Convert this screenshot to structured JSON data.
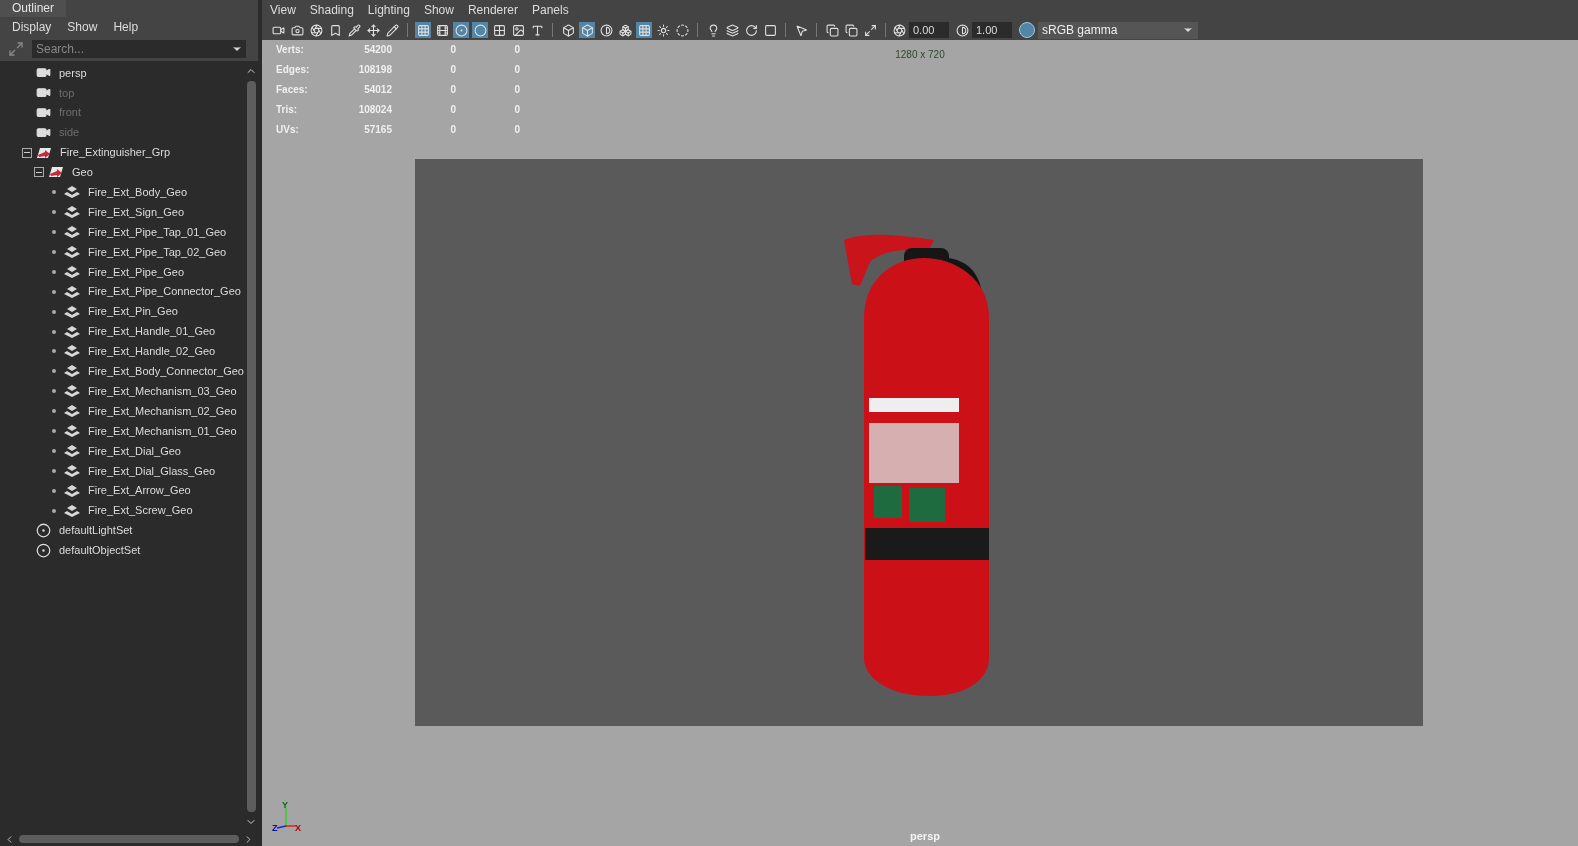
{
  "outliner": {
    "title": "Outliner",
    "menu": [
      "Display",
      "Show",
      "Help"
    ],
    "search": {
      "placeholder": "Search..."
    },
    "items": [
      {
        "kind": "camera",
        "label": "persp",
        "disabled": false
      },
      {
        "kind": "camera",
        "label": "top",
        "disabled": true
      },
      {
        "kind": "camera",
        "label": "front",
        "disabled": true
      },
      {
        "kind": "camera",
        "label": "side",
        "disabled": true
      },
      {
        "kind": "group",
        "label": "Fire_Extinguisher_Grp",
        "expanded": true,
        "children": [
          {
            "kind": "group",
            "label": "Geo",
            "expanded": true,
            "children": [
              {
                "kind": "mesh",
                "label": "Fire_Ext_Body_Geo"
              },
              {
                "kind": "mesh",
                "label": "Fire_Ext_Sign_Geo"
              },
              {
                "kind": "mesh",
                "label": "Fire_Ext_Pipe_Tap_01_Geo"
              },
              {
                "kind": "mesh",
                "label": "Fire_Ext_Pipe_Tap_02_Geo"
              },
              {
                "kind": "mesh",
                "label": "Fire_Ext_Pipe_Geo"
              },
              {
                "kind": "mesh",
                "label": "Fire_Ext_Pipe_Connector_Geo"
              },
              {
                "kind": "mesh",
                "label": "Fire_Ext_Pin_Geo"
              },
              {
                "kind": "mesh",
                "label": "Fire_Ext_Handle_01_Geo"
              },
              {
                "kind": "mesh",
                "label": "Fire_Ext_Handle_02_Geo"
              },
              {
                "kind": "mesh",
                "label": "Fire_Ext_Body_Connector_Geo"
              },
              {
                "kind": "mesh",
                "label": "Fire_Ext_Mechanism_03_Geo"
              },
              {
                "kind": "mesh",
                "label": "Fire_Ext_Mechanism_02_Geo"
              },
              {
                "kind": "mesh",
                "label": "Fire_Ext_Mechanism_01_Geo"
              },
              {
                "kind": "mesh",
                "label": "Fire_Ext_Dial_Geo"
              },
              {
                "kind": "mesh",
                "label": "Fire_Ext_Dial_Glass_Geo"
              },
              {
                "kind": "mesh",
                "label": "Fire_Ext_Arrow_Geo"
              },
              {
                "kind": "mesh",
                "label": "Fire_Ext_Screw_Geo"
              }
            ]
          }
        ]
      },
      {
        "kind": "set",
        "label": "defaultLightSet"
      },
      {
        "kind": "set",
        "label": "defaultObjectSet"
      }
    ]
  },
  "viewport": {
    "menu": [
      "View",
      "Shading",
      "Lighting",
      "Show",
      "Renderer",
      "Panels"
    ],
    "toolbar": [
      {
        "selected": false
      },
      {
        "selected": false
      },
      {
        "selected": false
      },
      {
        "selected": false
      },
      {
        "selected": false
      },
      {
        "selected": false
      },
      {
        "selected": false
      },
      {
        "selected": true
      },
      {
        "selected": false
      },
      {
        "selected": true
      },
      {
        "selected": true
      },
      {
        "selected": false
      },
      {
        "selected": false
      },
      {
        "selected": false
      },
      {
        "selected": false
      },
      {
        "selected": true
      },
      {
        "selected": false
      },
      {
        "selected": false
      },
      {
        "selected": true
      },
      {
        "selected": false
      },
      {
        "selected": false
      },
      {
        "selected": false
      },
      {
        "selected": false
      },
      {
        "selected": false
      },
      {
        "selected": false
      },
      {
        "selected": false
      },
      {
        "selected": false
      },
      {
        "selected": false
      },
      {
        "selected": false
      }
    ],
    "exposure": "0.00",
    "gamma": "1.00",
    "color_management_on": true,
    "color_space": "sRGB gamma",
    "stats": [
      {
        "label": "Verts:",
        "values": [
          "54200",
          "0",
          "0"
        ]
      },
      {
        "label": "Edges:",
        "values": [
          "108198",
          "0",
          "0"
        ]
      },
      {
        "label": "Faces:",
        "values": [
          "54012",
          "0",
          "0"
        ]
      },
      {
        "label": "Tris:",
        "values": [
          "108024",
          "0",
          "0"
        ]
      },
      {
        "label": "UVs:",
        "values": [
          "57165",
          "0",
          "0"
        ]
      }
    ],
    "resolution": "1280 x 720",
    "axes": {
      "y": "Y",
      "z": "Z",
      "x": "X"
    },
    "camera": "persp"
  }
}
